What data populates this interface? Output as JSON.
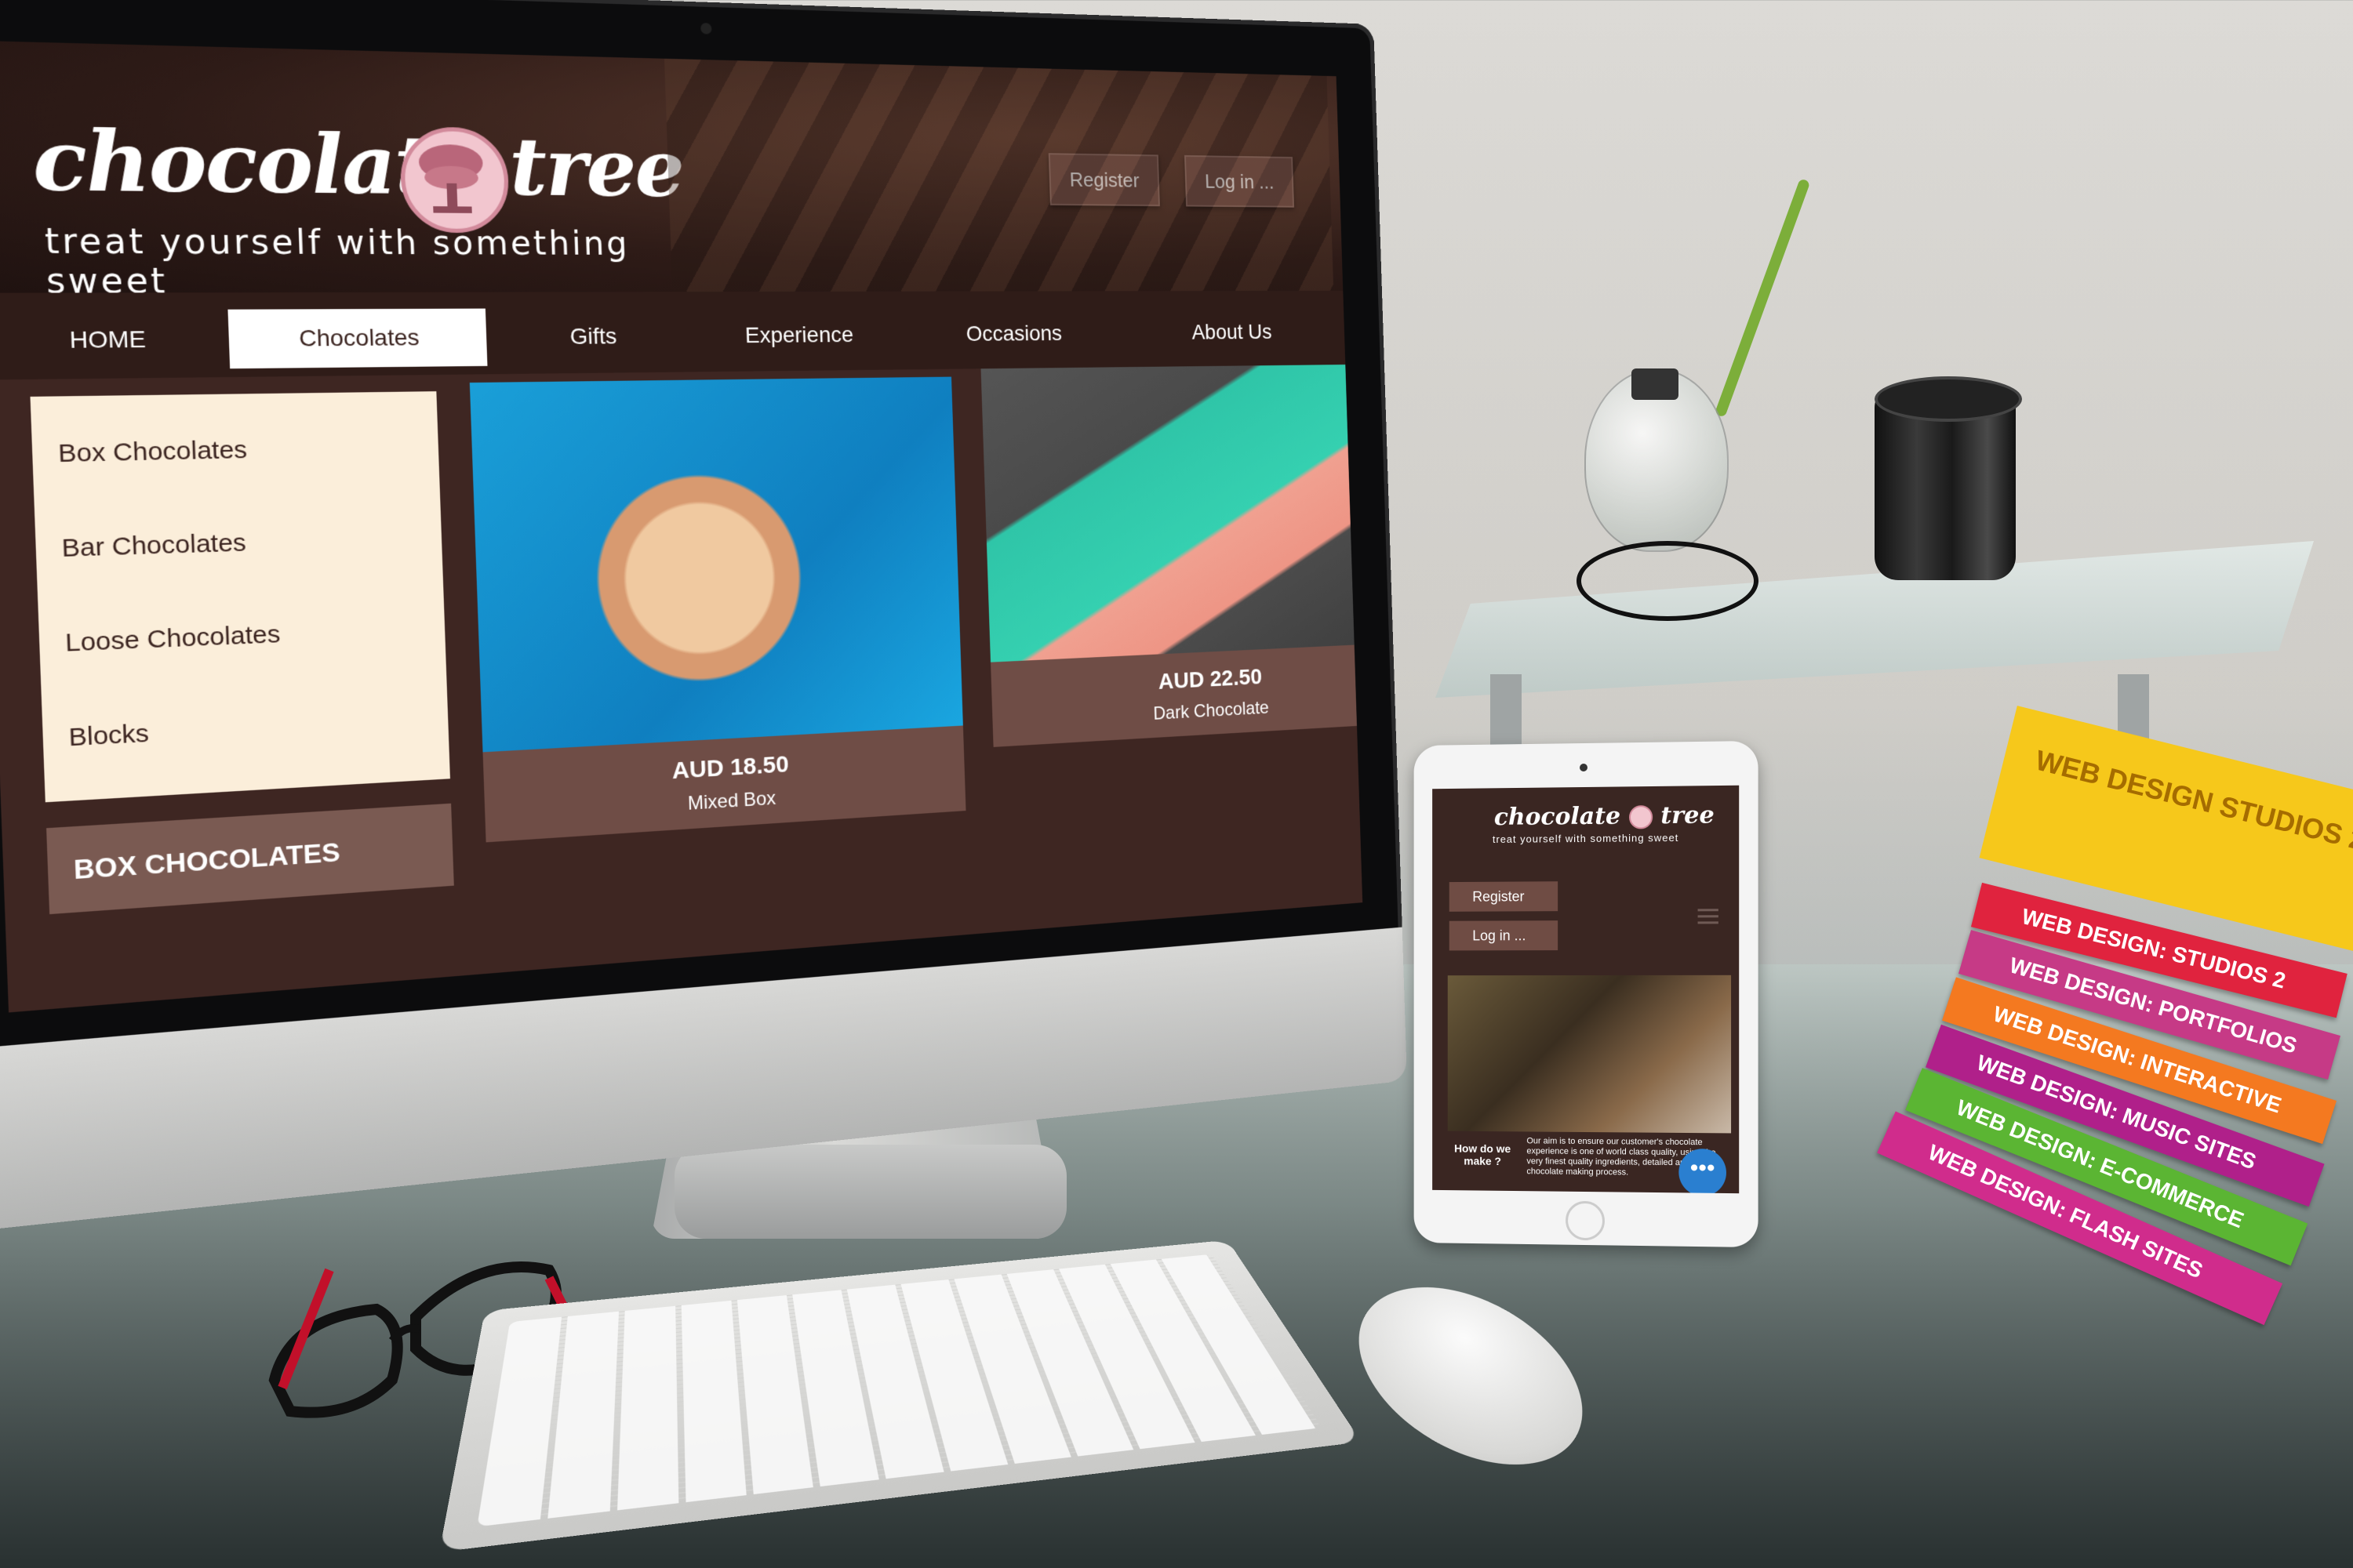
{
  "site": {
    "logo_word_1": "chocolate",
    "logo_word_2": "tree",
    "tagline": "treat yourself with something sweet",
    "header_buttons": {
      "register": "Register",
      "login": "Log in ..."
    },
    "nav": [
      {
        "label": "HOME",
        "active": false
      },
      {
        "label": "Chocolates",
        "active": true
      },
      {
        "label": "Gifts",
        "active": false
      },
      {
        "label": "Experience",
        "active": false
      },
      {
        "label": "Occasions",
        "active": false
      },
      {
        "label": "About Us",
        "active": false
      }
    ],
    "side_menu": [
      "Box Chocolates",
      "Bar Chocolates",
      "Loose Chocolates",
      "Blocks"
    ],
    "side_heading": "BOX CHOCOLATES",
    "products": [
      {
        "price": "AUD 18.50",
        "name": "Mixed Box",
        "image": "box-chocolates-photo"
      },
      {
        "price": "AUD 22.50",
        "name": "Dark Chocolate",
        "image": "hazelnut-bar-photo"
      }
    ]
  },
  "tablet": {
    "logo_word_1": "chocolate",
    "logo_word_2": "tree",
    "tagline": "treat yourself with something sweet",
    "register": "Register",
    "login": "Log in ...",
    "caption_left": "How do we make ?",
    "caption_right": "Our aim is to ensure our customer's chocolate experience is one of world class quality, using the very finest quality ingredients, detailed artisan chocolate making process.",
    "fab_icon": "more-icon",
    "fab_label": "•••"
  },
  "books": [
    {
      "label": "WEB DESIGN: STUDIOS 2",
      "color": "#e0233e"
    },
    {
      "label": "WEB DESIGN: PORTFOLIOS",
      "color": "#c63a86"
    },
    {
      "label": "WEB DESIGN: INTERACTIVE",
      "color": "#f47920"
    },
    {
      "label": "WEB DESIGN: MUSIC SITES",
      "color": "#b0208a"
    },
    {
      "label": "WEB DESIGN: E-COMMERCE",
      "color": "#5bb533"
    },
    {
      "label": "WEB DESIGN: FLASH SITES",
      "color": "#d02c8c"
    }
  ],
  "book_cover": "WEB DESIGN STUDIOS 2",
  "colors": {
    "site_dark": "#3b2420",
    "site_panel": "#6f4d46",
    "side_menu_bg": "#fbeeda",
    "logo_pink": "#d28a9b",
    "fab_blue": "#2a7fd0"
  }
}
